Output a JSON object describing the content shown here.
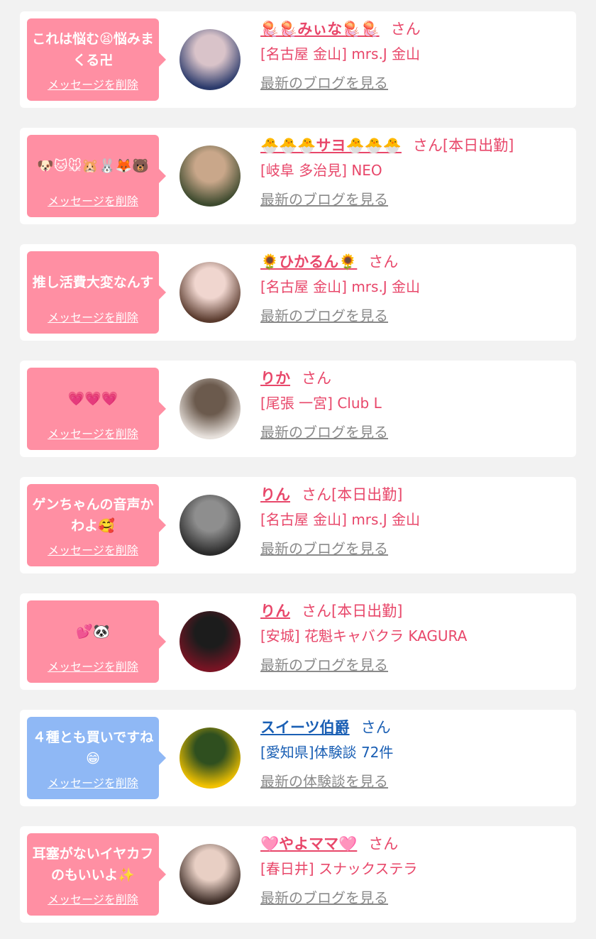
{
  "theme": {
    "pink_accent": "#e8476a",
    "pink_bubble": "#ff8fa3",
    "blue_accent": "#1a5fb4",
    "blue_bubble": "#8fb8f5",
    "link_gray": "#8a8a8a",
    "background": "#f2f2f2"
  },
  "delete_label": "メッセージを削除",
  "items": [
    {
      "message": "これは悩む😫悩みまくる卍",
      "name": "🪼🪼みぃな🪼🪼",
      "suffix": "さん",
      "shop": "[名古屋 金山] mrs.J 金山",
      "link": "最新のブログを見る",
      "bubble": "pink",
      "avatar_colors": [
        "#2b3a6b",
        "#d9c3c9"
      ]
    },
    {
      "message": "🐶🐱🐭🐹🐰🦊🐻",
      "name": "🐣🐣🐣サヨ🐣🐣🐣",
      "suffix": "さん[本日出勤]",
      "shop": "[岐阜 多治見] NEO",
      "link": "最新のブログを見る",
      "bubble": "pink",
      "avatar_colors": [
        "#3d4a2e",
        "#c9a78a"
      ]
    },
    {
      "message": "推し活費大変なんす",
      "name": "🌻ひかるん🌻",
      "suffix": "さん",
      "shop": "[名古屋 金山] mrs.J 金山",
      "link": "最新のブログを見る",
      "bubble": "pink",
      "avatar_colors": [
        "#5a3b2e",
        "#f0d6cf"
      ]
    },
    {
      "message": "💗💗💗",
      "name": "りか",
      "suffix": "さん",
      "shop": "[尾張 一宮] Club L",
      "link": "最新のブログを見る",
      "bubble": "pink",
      "avatar_colors": [
        "#e7e1dc",
        "#6b5a4d"
      ]
    },
    {
      "message": "ゲンちゃんの音声かわよ🥰",
      "name": "りん",
      "suffix": "さん[本日出勤]",
      "shop": "[名古屋 金山] mrs.J 金山",
      "link": "最新のブログを見る",
      "bubble": "pink",
      "avatar_colors": [
        "#2b2b2b",
        "#8e8e8e"
      ]
    },
    {
      "message": "💕🐼",
      "name": "りん",
      "suffix": "さん[本日出勤]",
      "shop": "[安城] 花魁キャバクラ KAGURA",
      "link": "最新のブログを見る",
      "bubble": "pink",
      "avatar_colors": [
        "#7a1424",
        "#1c1c1c"
      ]
    },
    {
      "message": "４種とも買いですね😁",
      "name": "スイーツ伯爵",
      "suffix": "さん",
      "shop": "[愛知県]体験談 72件",
      "link": "最新の体験談を見る",
      "bubble": "blue",
      "avatar_colors": [
        "#f2c200",
        "#2f4f1f"
      ]
    },
    {
      "message": "耳塞がないイヤカフのもいいよ✨",
      "name": "🩷やよママ🩷",
      "suffix": "さん",
      "shop": "[春日井] スナックステラ",
      "link": "最新のブログを見る",
      "bubble": "pink",
      "avatar_colors": [
        "#3a2a24",
        "#e8cfc4"
      ]
    }
  ]
}
